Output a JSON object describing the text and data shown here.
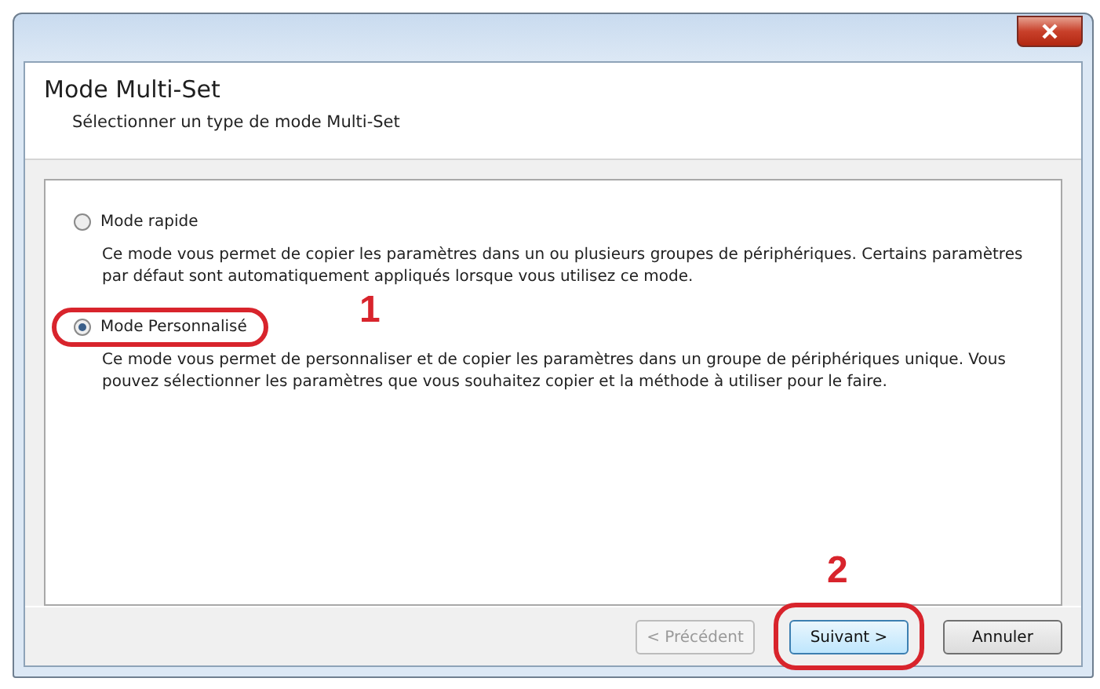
{
  "header": {
    "title": "Mode Multi-Set",
    "subtitle": "Sélectionner un type de mode Multi-Set"
  },
  "options": [
    {
      "label": "Mode rapide",
      "description": "Ce mode vous permet de copier les paramètres dans un ou plusieurs groupes de périphériques. Certains paramètres par défaut sont automatiquement appliqués lorsque vous utilisez ce mode.",
      "selected": false,
      "highlighted": false
    },
    {
      "label": "Mode Personnalisé",
      "description": "Ce mode vous permet de personnaliser et de copier les paramètres dans un groupe de périphériques unique. Vous pouvez sélectionner les paramètres que vous souhaitez copier et la méthode à utiliser pour le faire.",
      "selected": true,
      "highlighted": true,
      "callout": "1"
    }
  ],
  "buttons": [
    {
      "label": "< Précédent",
      "disabled": true,
      "highlighted": false
    },
    {
      "label": "Suivant >",
      "disabled": false,
      "highlighted": true,
      "callout": "2"
    },
    {
      "label": "Annuler",
      "disabled": false,
      "highlighted": false
    }
  ]
}
